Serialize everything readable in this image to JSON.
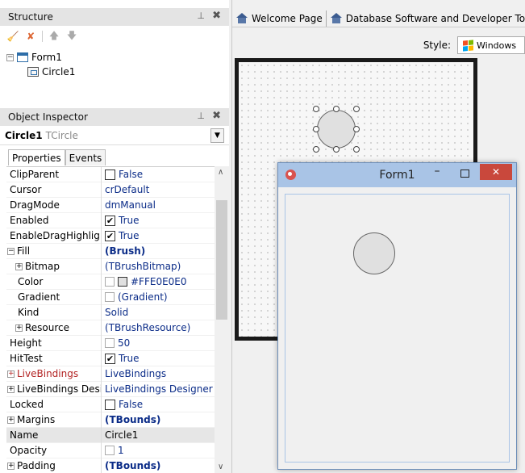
{
  "structure": {
    "title": "Structure",
    "tree": [
      {
        "label": "Form1"
      },
      {
        "label": "Circle1"
      }
    ]
  },
  "inspector": {
    "title": "Object Inspector",
    "selected_name": "Circle1",
    "selected_class": "TCircle",
    "tabs": [
      "Properties",
      "Events"
    ],
    "rows": [
      {
        "name": "ClipParent",
        "value": "False",
        "check": "",
        "kind": "check"
      },
      {
        "name": "Cursor",
        "value": "crDefault",
        "kind": "text"
      },
      {
        "name": "DragMode",
        "value": "dmManual",
        "kind": "text"
      },
      {
        "name": "Enabled",
        "value": "True",
        "check": "✔",
        "kind": "check"
      },
      {
        "name": "EnableDragHighlig",
        "value": "True",
        "check": "✔",
        "kind": "check"
      },
      {
        "name": "Fill",
        "value": "(Brush)",
        "kind": "bold",
        "expander": "⊟",
        "top": true
      },
      {
        "name": "Bitmap",
        "value": "(TBrushBitmap)",
        "kind": "text",
        "expander": "⊞",
        "indent": true
      },
      {
        "name": "Color",
        "value": "#FFE0E0E0",
        "kind": "color",
        "indent": true
      },
      {
        "name": "Gradient",
        "value": "(Gradient)",
        "kind": "link",
        "indent": true
      },
      {
        "name": "Kind",
        "value": "Solid",
        "kind": "text",
        "indent": true
      },
      {
        "name": "Resource",
        "value": "(TBrushResource)",
        "kind": "text",
        "expander": "⊞",
        "indent": true
      },
      {
        "name": "Height",
        "value": "50",
        "kind": "link"
      },
      {
        "name": "HitTest",
        "value": "True",
        "check": "✔",
        "kind": "check"
      },
      {
        "name": "LiveBindings",
        "value": "LiveBindings",
        "kind": "text",
        "expander": "⊞",
        "red": true
      },
      {
        "name": "LiveBindings Desig",
        "value": "LiveBindings Designer",
        "kind": "text",
        "expander": "⊞"
      },
      {
        "name": "Locked",
        "value": "False",
        "check": "",
        "kind": "check"
      },
      {
        "name": "Margins",
        "value": "(TBounds)",
        "kind": "bold",
        "expander": "⊞"
      },
      {
        "name": "Name",
        "value": "Circle1",
        "kind": "plain",
        "selected": true
      },
      {
        "name": "Opacity",
        "value": "1",
        "kind": "link"
      },
      {
        "name": "Padding",
        "value": "(TBounds)",
        "kind": "bold",
        "expander": "⊞"
      }
    ]
  },
  "doc_tabs": [
    "Welcome Page",
    "Database Software and Developer Tools"
  ],
  "style": {
    "label": "Style:",
    "value": "Windows"
  },
  "run_window": {
    "title": "Form1",
    "close_glyph": "✕",
    "min_glyph": "–"
  }
}
